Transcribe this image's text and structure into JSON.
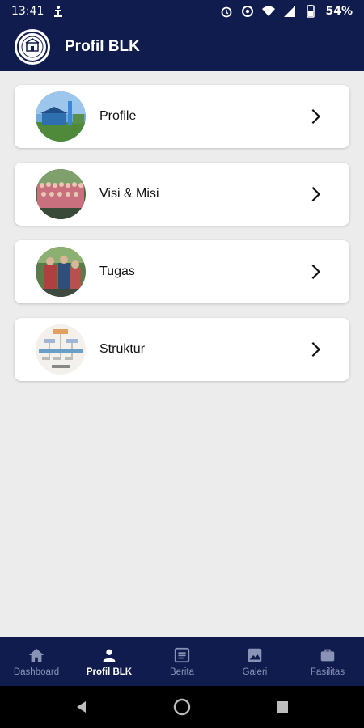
{
  "status_bar": {
    "time": "13:41",
    "battery": "54%"
  },
  "app_bar": {
    "title": "Profil BLK"
  },
  "menu": [
    {
      "label": "Profile"
    },
    {
      "label": "Visi & Misi"
    },
    {
      "label": "Tugas"
    },
    {
      "label": "Struktur"
    }
  ],
  "bottom_nav": [
    {
      "label": "Dashboard",
      "icon": "home-icon",
      "active": false
    },
    {
      "label": "Profil BLK",
      "icon": "person-icon",
      "active": true
    },
    {
      "label": "Berita",
      "icon": "news-icon",
      "active": false
    },
    {
      "label": "Galeri",
      "icon": "image-icon",
      "active": false
    },
    {
      "label": "Fasilitas",
      "icon": "briefcase-icon",
      "active": false
    }
  ],
  "colors": {
    "primary": "#0f1c4d",
    "background": "#ececec",
    "inactive_nav": "#8a93b5"
  }
}
